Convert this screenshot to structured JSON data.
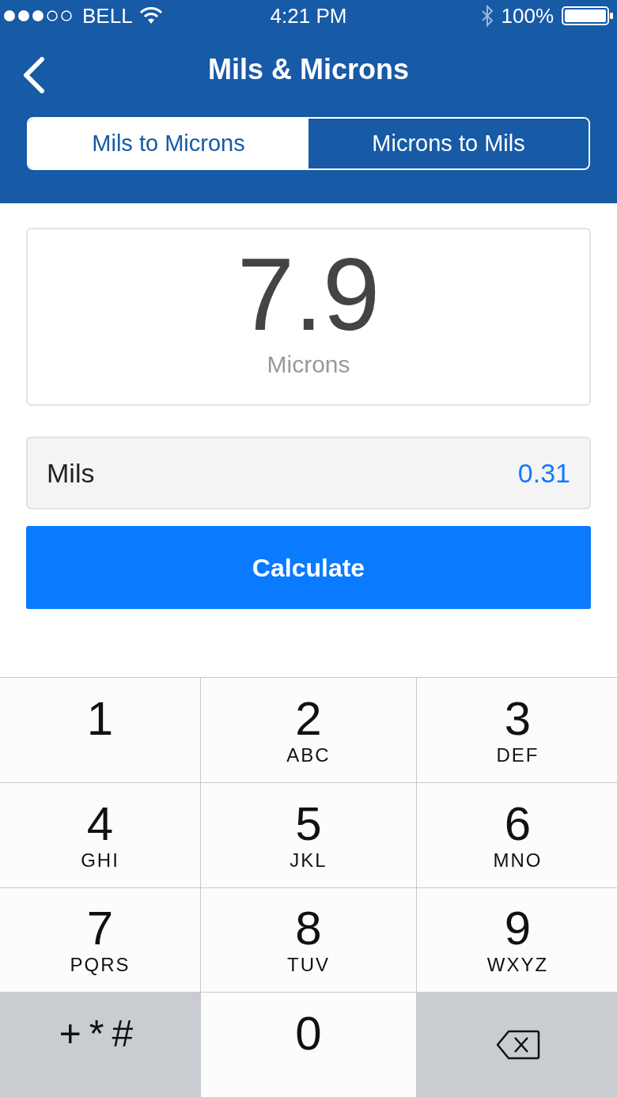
{
  "status_bar": {
    "carrier": "BELL",
    "time": "4:21 PM",
    "battery": "100%"
  },
  "nav": {
    "title": "Mils & Microns"
  },
  "segments": [
    {
      "label": "Mils to Microns",
      "selected": true
    },
    {
      "label": "Microns to Mils",
      "selected": false
    }
  ],
  "result": {
    "value": "7.9",
    "unit": "Microns"
  },
  "input": {
    "label": "Mils",
    "value": "0.31"
  },
  "button": "Calculate",
  "keypad": [
    {
      "kind": "digit",
      "digit": "1"
    },
    {
      "kind": "digit",
      "digit": "2",
      "letters": "ABC"
    },
    {
      "kind": "digit",
      "digit": "3",
      "letters": "DEF"
    },
    {
      "kind": "digit",
      "digit": "4",
      "letters": "GHI"
    },
    {
      "kind": "digit",
      "digit": "5",
      "letters": "JKL"
    },
    {
      "kind": "digit",
      "digit": "6",
      "letters": "MNO"
    },
    {
      "kind": "digit",
      "digit": "7",
      "letters": "PQRS"
    },
    {
      "kind": "digit",
      "digit": "8",
      "letters": "TUV"
    },
    {
      "kind": "digit",
      "digit": "9",
      "letters": "WXYZ"
    },
    {
      "kind": "symbols",
      "symbols": "+*#"
    },
    {
      "kind": "digit",
      "digit": "0"
    },
    {
      "kind": "backspace"
    }
  ]
}
